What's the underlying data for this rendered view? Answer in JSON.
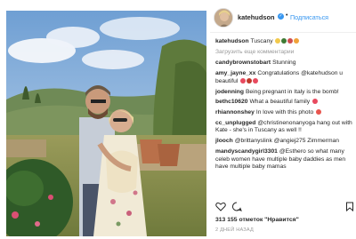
{
  "header": {
    "username": "katehudson",
    "separator": "•",
    "follow_label": "Подписаться"
  },
  "caption": {
    "username": "katehudson",
    "text": "Tuscany"
  },
  "load_more": "Загрузить еще комментарии",
  "comments": [
    {
      "user": "candybrownstobart",
      "text": "Stunning"
    },
    {
      "user": "amy_jayne_xx",
      "text": "Congratulations @katehudson u beautiful"
    },
    {
      "user": "jodenning",
      "text": "Being pregnant in Italy is the bomb!"
    },
    {
      "user": "bethc10620",
      "text": "What a beautiful family"
    },
    {
      "user": "rhiannonshey",
      "text": "In love with this photo"
    },
    {
      "user": "cc_unplugged",
      "text": "@christinenonanyoga hang out with Kate - she's in Tuscany as well !!"
    },
    {
      "user": "jlooch",
      "text": "@brittanyslink @angiej275 Zimmerman"
    },
    {
      "user": "mandyscandygirl3301",
      "text": "@Esthero so what many celeb women have multiple baby daddies as men have multiple baby mamas"
    }
  ],
  "likes": "313 155 отметок \"Нравится\"",
  "timestamp": "2 ДНЕЙ НАЗАД",
  "colors": {
    "link": "#3897f0",
    "text": "#262626",
    "muted": "#999999",
    "heart": "#ed4956"
  }
}
